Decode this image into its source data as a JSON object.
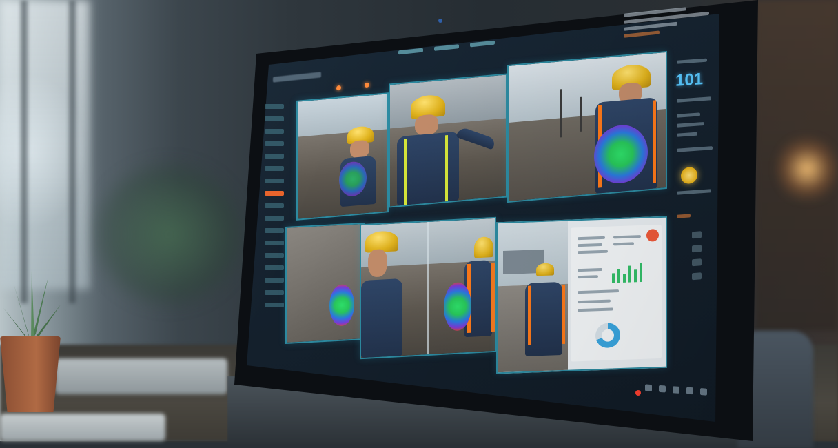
{
  "scene": {
    "description_type": "photo of a monitor showing a construction-site worker safety monitoring dashboard"
  },
  "dashboard": {
    "metric_value": "101",
    "accent_color": "#58c8ff",
    "alert_color": "#ff8a3a",
    "panel_border_color": "#2d8aa0"
  },
  "panels": [
    {
      "id": "camera-feed-1",
      "has_caption": false
    },
    {
      "id": "camera-feed-2",
      "has_caption": false
    },
    {
      "id": "camera-feed-3",
      "has_caption": false
    },
    {
      "id": "camera-feed-4",
      "has_caption": false
    },
    {
      "id": "camera-feed-5",
      "has_caption": false
    },
    {
      "id": "report-panel",
      "has_caption": false
    }
  ],
  "icons": [
    "webcam-icon",
    "record-icon",
    "alert-icon",
    "status-icon"
  ]
}
